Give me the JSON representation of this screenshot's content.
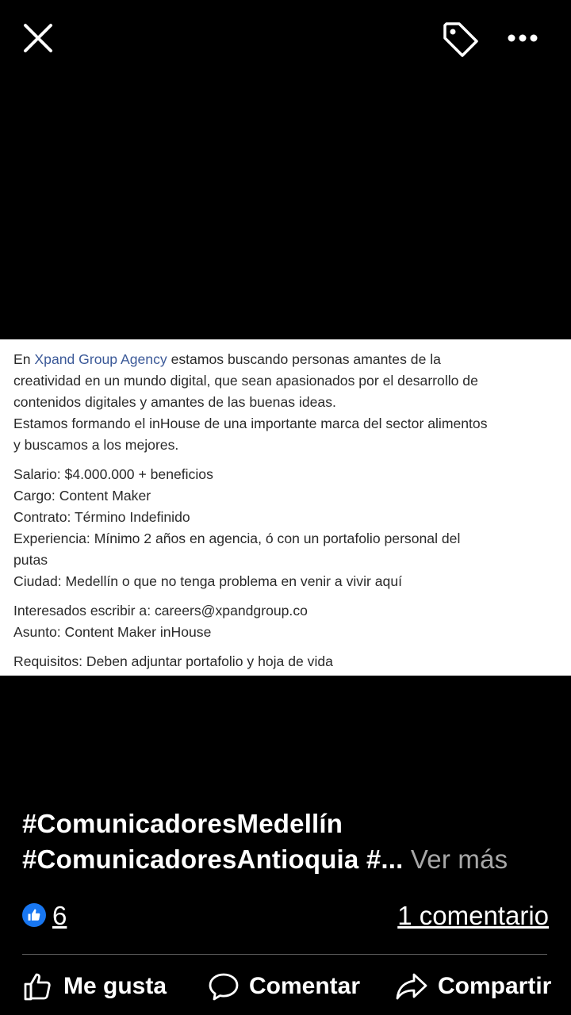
{
  "top_bar": {
    "close_icon": "close-icon",
    "tag_icon": "tag-icon",
    "more_icon": "more-horizontal-icon"
  },
  "photo": {
    "intro_prefix": "En ",
    "company_link": "Xpand Group Agency",
    "intro_rest_1": " estamos buscando personas amantes de la",
    "line2": "creatividad en un mundo digital, que sean apasionados por el desarrollo de",
    "line3": "contenidos digitales y amantes de las buenas ideas.",
    "line4": "Estamos formando el inHouse de una importante marca del sector alimentos",
    "line5": "y buscamos a los mejores.",
    "salario": "Salario: $4.000.000 + beneficios",
    "cargo": "Cargo: Content Maker",
    "contrato": "Contrato: Término Indefinido",
    "experiencia_1": "Experiencia: Mínimo 2 años en agencia, ó con un portafolio personal del",
    "experiencia_2": "putas",
    "ciudad": "Ciudad: Medellín o que no tenga problema en venir a vivir aquí",
    "interesados": "Interesados escribir a: careers@xpandgroup.co",
    "asunto": "Asunto: Content Maker inHouse",
    "requisitos": "Requisitos: Deben adjuntar portafolio y hoja de vida"
  },
  "caption": {
    "line1": "#ComunicadoresMedellín",
    "line2": "#ComunicadoresAntioquia #...",
    "see_more": "Ver más"
  },
  "reactions": {
    "count": "6",
    "comments": "1 comentario",
    "like_color": "#1877f2"
  },
  "actions": {
    "like": "Me gusta",
    "comment": "Comentar",
    "share": "Compartir"
  }
}
